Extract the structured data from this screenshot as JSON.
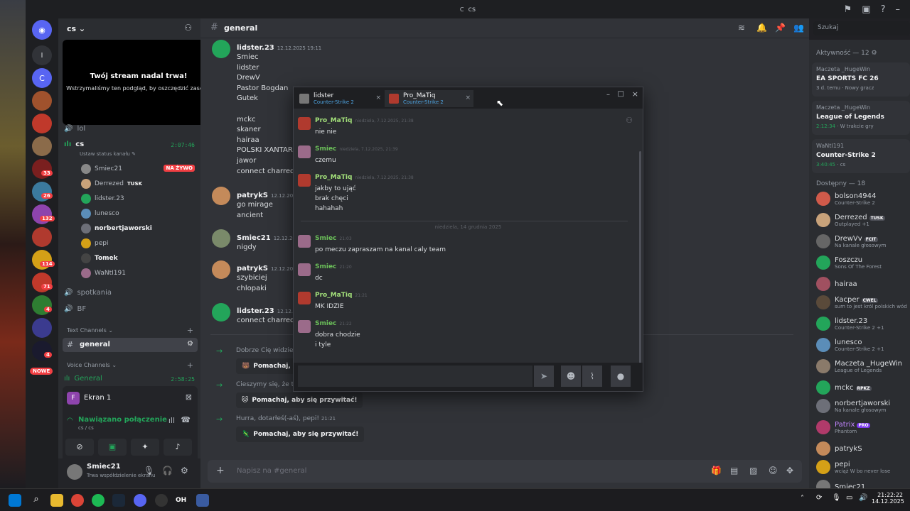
{
  "window": {
    "title": "cs",
    "app_icon_letter": "C"
  },
  "server": {
    "name": "cs"
  },
  "stream_notice": {
    "title": "Twój stream nadal trwa!",
    "subtitle": "Wstrzymaliśmy ten podgląd, by oszczędzić zasoby."
  },
  "channels": {
    "lol": "lol",
    "cs": "cs",
    "cs_timer": "2:07:46",
    "cs_status": "Ustaw status kanału",
    "live_badge": "NA ŻYWO",
    "voice_users": [
      {
        "name": "Smiec21",
        "tag": ""
      },
      {
        "name": "Derrezed",
        "tag": "TUSK"
      },
      {
        "name": "lidster.23",
        "tag": ""
      },
      {
        "name": "lunesco",
        "tag": ""
      },
      {
        "name": "norbertjaworski",
        "tag": ""
      },
      {
        "name": "pepi",
        "tag": ""
      },
      {
        "name": "Tomek",
        "tag": ""
      },
      {
        "name": "WaNtI191",
        "tag": ""
      }
    ],
    "spotkania": "spotkania",
    "bf": "BF",
    "text_header": "Text Channels",
    "general": "general",
    "voice_header": "Voice Channels",
    "voice_general": "General",
    "voice_general_timer": "2:58:25"
  },
  "screen_share": {
    "label": "Ekran 1",
    "letter": "F"
  },
  "connection": {
    "status": "Nawiązano połączenie",
    "channel": "cs / cs"
  },
  "user": {
    "name": "Smiec21",
    "status": "Trwa współdzielenie ekranu"
  },
  "nowe_badge": "NOWE",
  "chat": {
    "channel": "general",
    "messages": [
      {
        "author": "lidster.23",
        "time": "12.12.2025 19:11",
        "lines": [
          "Smiec",
          "lidster",
          "DrewV",
          "Pastor Bogdan",
          "Gutek",
          "",
          "mckc",
          "skaner",
          "hairaa",
          "POLSKI XANTARE",
          "jawor",
          "connect charred."
        ]
      },
      {
        "author": "patrykS",
        "time": "12.12.2025",
        "lines": [
          "go mirage",
          "ancient"
        ]
      },
      {
        "author": "Smiec21",
        "time": "12.12.2025",
        "lines": [
          "nigdy"
        ]
      },
      {
        "author": "patrykS",
        "time": "12.12.2025",
        "lines": [
          "szybiciej",
          "chlopaki"
        ]
      },
      {
        "author": "lidster.23",
        "time": "12.12.2025",
        "lines": [
          "connect charred."
        ]
      }
    ],
    "system": [
      {
        "text": "Dobrze Cię widzieć",
        "button": "Pomachaj,"
      },
      {
        "text": "Cieszymy się, że t",
        "button": "Pomachaj, aby się przywitać!"
      },
      {
        "text": "Hurra, dotarłeś(-aś), pepi!",
        "time": "21:21",
        "button": "Pomachaj, aby się przywitać!"
      }
    ],
    "input_placeholder": "Napisz na #general",
    "search_placeholder": "Szukaj"
  },
  "popup": {
    "tabs": [
      {
        "name": "lidster",
        "game": "Counter-Strike 2"
      },
      {
        "name": "Pro_MaTiq",
        "game": "Counter-Strike 2"
      }
    ],
    "messages": [
      {
        "author": "Pro_MaTiq",
        "time": "niedziela, 7.12.2025, 21:38",
        "lines": [
          "nie nie"
        ],
        "color": "#a3e07a"
      },
      {
        "author": "Smiec",
        "time": "niedziela, 7.12.2025, 21:39",
        "lines": [
          "czemu"
        ],
        "color": "#6bbf59"
      },
      {
        "author": "Pro_MaTiq",
        "time": "niedziela, 7.12.2025, 21:38",
        "lines": [
          "jakby to ująć",
          "brak chęci",
          "hahahah"
        ],
        "color": "#a3e07a"
      },
      {
        "author": "Smiec",
        "time": "21:03",
        "lines": [
          "po meczu zapraszam na kanal caly team"
        ],
        "color": "#6bbf59"
      },
      {
        "author": "Smiec",
        "time": "21:20",
        "lines": [
          "dc"
        ],
        "color": "#6bbf59"
      },
      {
        "author": "Pro_MaTiq",
        "time": "21:21",
        "lines": [
          "MK IDZIE"
        ],
        "color": "#a3e07a"
      },
      {
        "author": "Smiec",
        "time": "21:22",
        "lines": [
          "dobra chodzie",
          "i tyle"
        ],
        "color": "#6bbf59"
      }
    ],
    "divider": "niedziela, 14 grudnia 2025"
  },
  "members": {
    "activity_header": "Aktywność — 12",
    "activities": [
      {
        "user": "Maczeta _HugeWin",
        "game": "EA SPORTS FC 26",
        "detail": "3 d. temu",
        "extra": "Nowy gracz"
      },
      {
        "user": "Maczeta _HugeWin",
        "game": "League of Legends",
        "detail": "2:12:34",
        "extra": "W trakcie gry"
      },
      {
        "user": "WaNtI191",
        "game": "Counter-Strike 2",
        "detail": "3:40:45",
        "extra": "cs"
      }
    ],
    "online_header": "Dostępny — 18",
    "online": [
      {
        "name": "bolson4944",
        "sub": "Counter-Strike 2",
        "tag": ""
      },
      {
        "name": "Derrezed",
        "sub": "Outplayed +1",
        "tag": "TUSK"
      },
      {
        "name": "DrewVv",
        "sub": "Na kanale głosowym",
        "tag": "FCIT"
      },
      {
        "name": "Foszczu",
        "sub": "Sons Of The Forest",
        "tag": ""
      },
      {
        "name": "hairaa",
        "sub": "",
        "tag": ""
      },
      {
        "name": "Kacper",
        "sub": "sum to jest król polskich wód",
        "tag": "CWEL"
      },
      {
        "name": "lidster.23",
        "sub": "Counter-Strike 2 +1",
        "tag": ""
      },
      {
        "name": "lunesco",
        "sub": "Counter-Strike 2 +1",
        "tag": ""
      },
      {
        "name": "Maczeta _HugeWin",
        "sub": "League of Legends",
        "tag": ""
      },
      {
        "name": "mckc",
        "sub": "",
        "tag": "RPKZ"
      },
      {
        "name": "norbertjaworski",
        "sub": "Na kanale głosowym",
        "tag": ""
      },
      {
        "name": "Patrix",
        "sub": "Phantom",
        "tag": "PRO"
      },
      {
        "name": "patrykS",
        "sub": "",
        "tag": ""
      },
      {
        "name": "pepi",
        "sub": "wciąż W bo never lose",
        "tag": ""
      },
      {
        "name": "Smiec21",
        "sub": "",
        "tag": ""
      }
    ]
  },
  "taskbar": {
    "time": "21:22:22",
    "date": "14.12.2025",
    "oh_label": "OH"
  },
  "guild_badges": [
    "33",
    "26",
    "132",
    "114",
    "71",
    "4",
    "4"
  ],
  "colors": {
    "accent": "#5865f2",
    "green": "#23a55a",
    "red": "#f23f43",
    "bg": "#313338"
  }
}
